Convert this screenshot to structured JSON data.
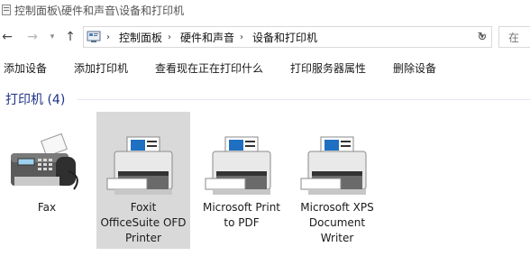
{
  "titlebar": {
    "path_text": "控制面板\\硬件和声音\\设备和打印机"
  },
  "address": {
    "crumbs": [
      "控制面板",
      "硬件和声音",
      "设备和打印机"
    ],
    "search_placeholder": "在"
  },
  "commands": [
    "添加设备",
    "添加打印机",
    "查看现在正在打印什么",
    "打印服务器属性",
    "删除设备"
  ],
  "group": {
    "title": "打印机 (4)"
  },
  "devices": [
    {
      "label": "Fax",
      "icon": "fax-icon",
      "selected": false
    },
    {
      "label": "Foxit\nOfficeSuite OFD\nPrinter",
      "icon": "printer-icon",
      "selected": true
    },
    {
      "label": "Microsoft Print\nto PDF",
      "icon": "printer-icon",
      "selected": false
    },
    {
      "label": "Microsoft XPS\nDocument\nWriter",
      "icon": "printer-icon",
      "selected": false
    }
  ],
  "colors": {
    "group_header": "#1e3287",
    "selection": "#d9d9d9"
  }
}
